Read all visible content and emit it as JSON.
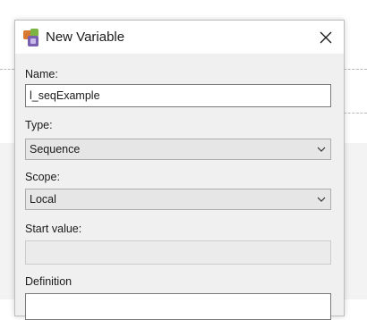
{
  "dialog": {
    "title": "New Variable",
    "close_icon": "close-icon",
    "app_icon": "variable-app-icon"
  },
  "form": {
    "name_label": "Name:",
    "name_value": "l_seqExample",
    "type_label": "Type:",
    "type_value": "Sequence",
    "scope_label": "Scope:",
    "scope_value": "Local",
    "start_value_label": "Start value:",
    "start_value_value": "",
    "definition_label": "Definition"
  },
  "colors": {
    "dialog_bg": "#f0f0f0",
    "titlebar_bg": "#ffffff",
    "combo_bg": "#e6e6e6",
    "disabled_bg": "#ebebeb"
  }
}
